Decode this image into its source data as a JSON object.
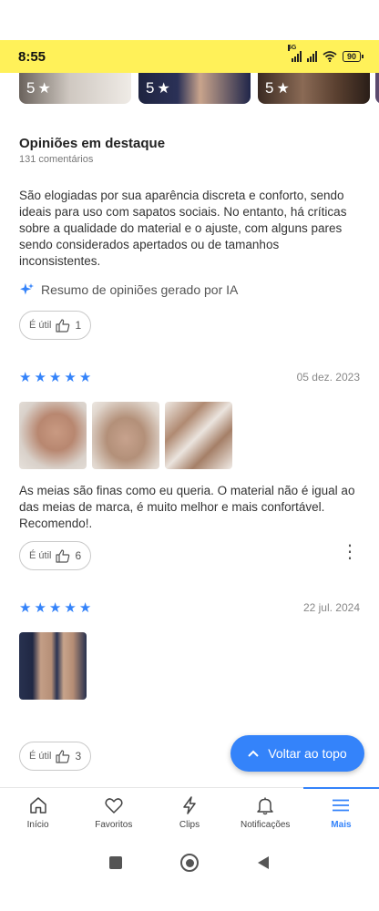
{
  "status_bar": {
    "time": "8:55",
    "network": "5G",
    "battery": "90"
  },
  "gallery": [
    {
      "rating": "5"
    },
    {
      "rating": "5"
    },
    {
      "rating": "5"
    }
  ],
  "highlights": {
    "title": "Opiniões em destaque",
    "count": "131 comentários",
    "summary": "São elogiadas por sua aparência discreta e conforto, sendo ideais para uso com sapatos sociais. No entanto, há críticas sobre a qualidade do material e o ajuste, com alguns pares sendo considerados apertados ou de tamanhos inconsistentes.",
    "ai_label": "Resumo de opiniões gerado por IA",
    "useful_label": "É útil",
    "useful_count": "1"
  },
  "reviews": [
    {
      "rating": 5,
      "date": "05 dez. 2023",
      "text": "As meias são finas como eu queria. O material não é igual ao das meias de marca, é muito melhor e mais confortável. Recomendo!.",
      "useful_label": "É útil",
      "useful_count": "6"
    },
    {
      "rating": 5,
      "date": "22 jul. 2024",
      "text": "",
      "useful_label": "É útil",
      "useful_count": "3"
    }
  ],
  "back_to_top": "Voltar ao topo",
  "nav": [
    {
      "label": "Início",
      "icon": "home-icon"
    },
    {
      "label": "Favoritos",
      "icon": "heart-icon"
    },
    {
      "label": "Clips",
      "icon": "lightning-icon"
    },
    {
      "label": "Notificações",
      "icon": "bell-icon"
    },
    {
      "label": "Mais",
      "icon": "menu-icon",
      "active": true
    }
  ],
  "colors": {
    "accent": "#3483fa",
    "statusbar": "#fff159"
  }
}
